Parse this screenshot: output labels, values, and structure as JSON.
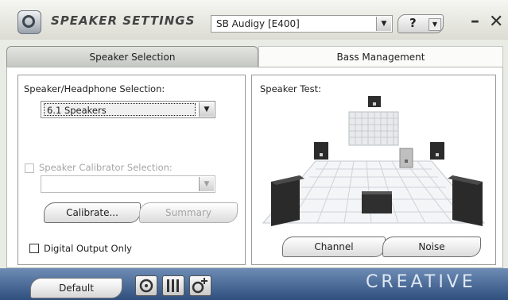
{
  "window": {
    "title": "SPEAKER SETTINGS",
    "device_selected": "SB Audigy [E400]",
    "help_label": "?"
  },
  "tabs": [
    {
      "label": "Speaker Selection",
      "active": true
    },
    {
      "label": "Bass Management",
      "active": false
    }
  ],
  "speaker_panel": {
    "selection_label": "Speaker/Headphone Selection:",
    "selection_value": "6.1 Speakers",
    "calibrator_label": "Speaker Calibrator Selection:",
    "calibrator_value": "",
    "calibrator_checked": false,
    "calibrate_button": "Calibrate...",
    "summary_button": "Summary",
    "digital_output_label": "Digital Output Only",
    "digital_output_checked": false
  },
  "test_panel": {
    "label": "Speaker Test:",
    "channel_button": "Channel",
    "noise_button": "Noise"
  },
  "footer": {
    "default_button": "Default",
    "logo": "CREATIVE"
  },
  "colors": {
    "footer_top": "#6d8cb5",
    "footer_bottom": "#2f4f7e",
    "window_bg": "#e9ebe5"
  }
}
